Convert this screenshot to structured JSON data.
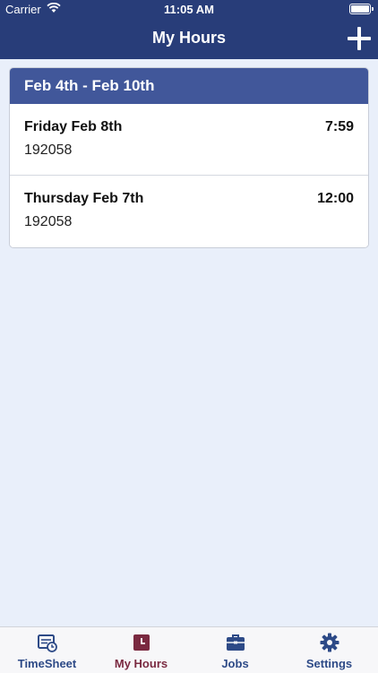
{
  "status_bar": {
    "carrier": "Carrier",
    "time": "11:05 AM"
  },
  "nav": {
    "title": "My Hours"
  },
  "week": {
    "range": "Feb 4th - Feb 10th",
    "entries": [
      {
        "day": "Friday Feb 8th",
        "job": "192058",
        "hours": "7:59"
      },
      {
        "day": "Thursday Feb 7th",
        "job": "192058",
        "hours": "12:00"
      }
    ]
  },
  "tabs": [
    {
      "label": "TimeSheet",
      "icon": "timesheet-icon",
      "active": false
    },
    {
      "label": "My Hours",
      "icon": "clock-icon",
      "active": true
    },
    {
      "label": "Jobs",
      "icon": "briefcase-icon",
      "active": false
    },
    {
      "label": "Settings",
      "icon": "gear-icon",
      "active": false
    }
  ],
  "colors": {
    "header": "#283d79",
    "card_header": "#41579a",
    "tab_active": "#7a2940",
    "tab_inactive": "#2d4a87",
    "background": "#e9effa"
  }
}
